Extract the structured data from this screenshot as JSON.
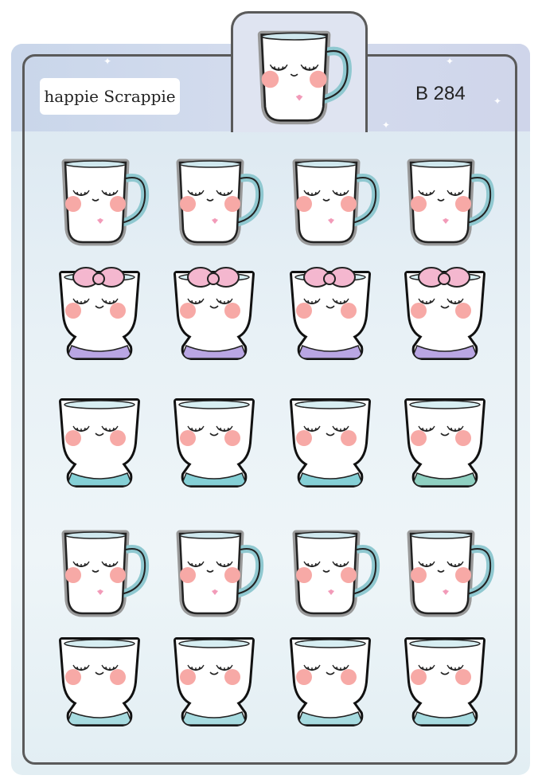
{
  "brand": {
    "logo_text": "happie Scrappie"
  },
  "sheet": {
    "code": "B 284"
  },
  "colors": {
    "mug_handle": "#8fc8d0",
    "cheek": "#f7a9a6",
    "bow": "#f4b7cf",
    "collar_lilac": "#b9a6e3",
    "collar_aqua": "#85d0d6",
    "collar_mint": "#8fd0c1",
    "collar_glitter": "#a7dbe0",
    "heart": "#f29ab8",
    "outline": "#222222"
  },
  "stickers": {
    "header": {
      "type": "mug-handle-heart",
      "icon": "sleepy-mug-icon"
    },
    "rows": [
      {
        "type": "mug-handle-heart",
        "count": 4
      },
      {
        "type": "cup-bow-lilac-collar",
        "count": 4
      },
      {
        "type": "cup-aqua-collar",
        "count": 4
      },
      {
        "type": "mug-handle-heart",
        "count": 4
      },
      {
        "type": "cup-glitter-collar",
        "count": 4
      }
    ]
  }
}
